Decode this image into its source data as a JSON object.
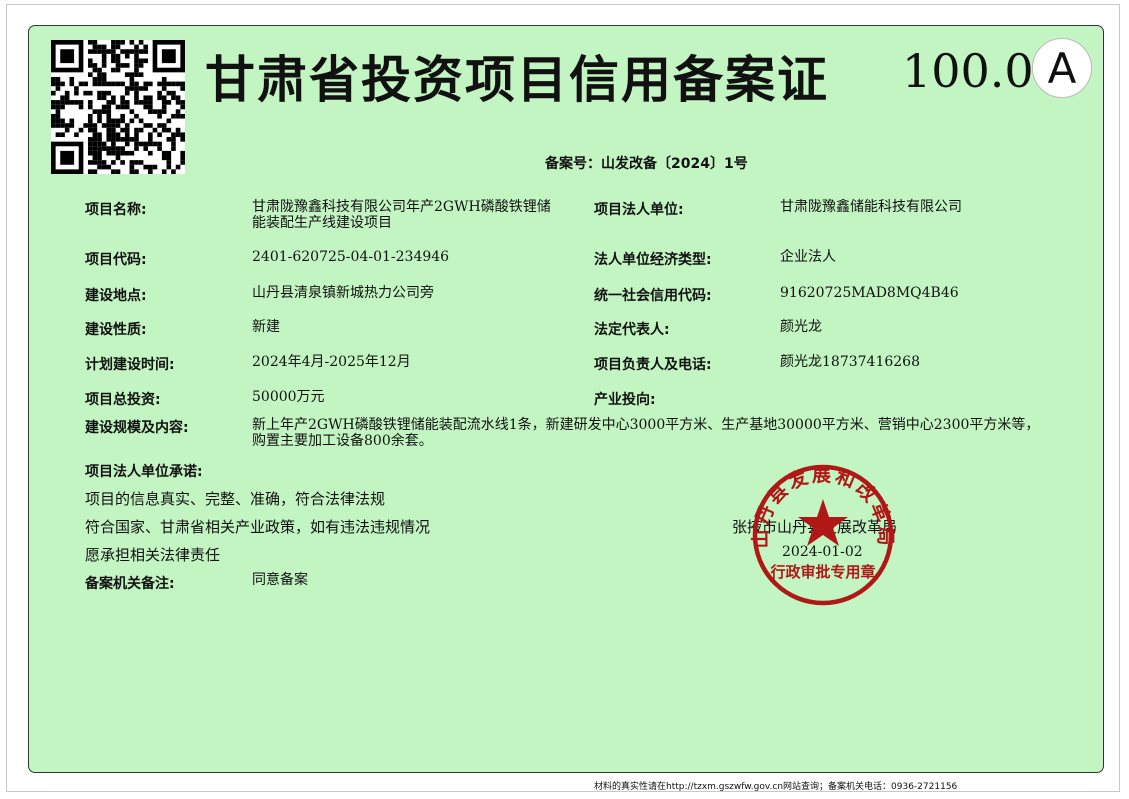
{
  "certificate": {
    "title": "甘肃省投资项目信用备案证",
    "score": "100.0",
    "grade": "A",
    "record_no": "备案号：山发改备〔2024〕1号"
  },
  "left_fields": [
    {
      "label": "项目名称:",
      "value": "甘肃陇豫鑫科技有限公司年产2GWH磷酸铁锂储能装配生产线建设项目"
    },
    {
      "label": "项目代码:",
      "value": "2401-620725-04-01-234946"
    },
    {
      "label": "建设地点:",
      "value": "山丹县清泉镇新城热力公司旁"
    },
    {
      "label": "建设性质:",
      "value": "新建"
    },
    {
      "label": "计划建设时间:",
      "value": "2024年4月-2025年12月"
    },
    {
      "label": "项目总投资:",
      "value": "50000万元"
    }
  ],
  "right_fields": [
    {
      "label": "项目法人单位:",
      "value": "甘肃陇豫鑫储能科技有限公司"
    },
    {
      "label": "法人单位经济类型:",
      "value": "企业法人"
    },
    {
      "label": "统一社会信用代码:",
      "value": "91620725MAD8MQ4B46"
    },
    {
      "label": "法定代表人:",
      "value": "颜光龙"
    },
    {
      "label": "项目负责人及电话:",
      "value": "颜光龙18737416268"
    },
    {
      "label": "产业投向:",
      "value": ""
    }
  ],
  "scale": {
    "label": "建设规模及内容:",
    "value": "新上年产2GWH磷酸铁锂储能装配流水线1条，新建研发中心3000平方米、生产基地30000平方米、营销中心2300平方米等，购置主要加工设备800余套。"
  },
  "commitment": {
    "label": "项目法人单位承诺:",
    "lines": [
      "项目的信息真实、完整、准确，符合法律法规",
      "符合国家、甘肃省相关产业政策，如有违法违规情况",
      "愿承担相关法律责任"
    ]
  },
  "remarks": {
    "label": "备案机关备注:",
    "value": "同意备案"
  },
  "issuer": {
    "name": "张掖市山丹县发展改革局",
    "date": "2024-01-02"
  },
  "seal": {
    "ring_text": "山丹县发展和改革局",
    "bottom_text": "行政审批专用章",
    "color": "#b01818"
  },
  "footer": {
    "text": "材料的真实性请在http://tzxm.gszwfw.gov.cn网站查询；备案机关电话：0936-2721156"
  },
  "colors": {
    "background": "#c2f5c2",
    "seal": "#b01818"
  }
}
